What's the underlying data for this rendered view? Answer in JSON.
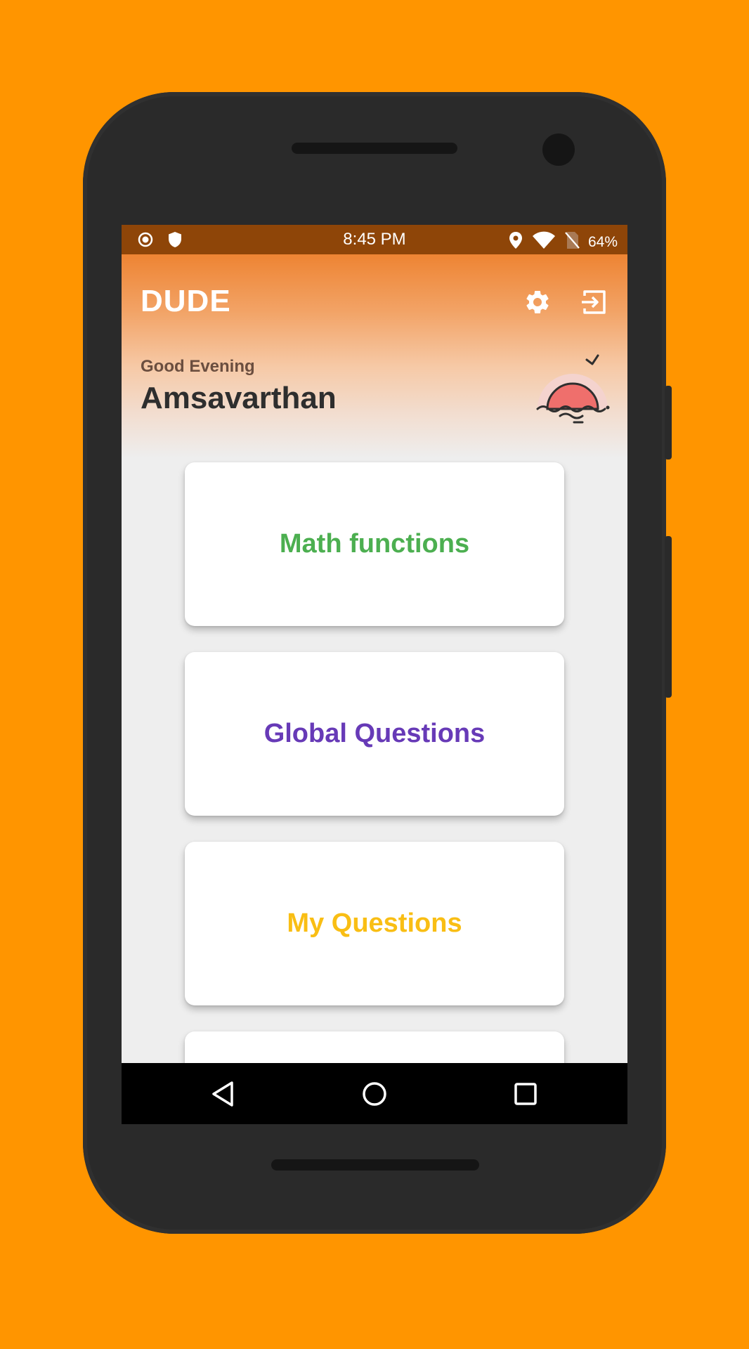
{
  "status_bar": {
    "time": "8:45 PM",
    "battery_percent": "64%",
    "left_icons": [
      "record-icon",
      "shield-icon"
    ],
    "right_icons": [
      "location-icon",
      "wifi-icon",
      "no-sim-icon"
    ]
  },
  "app_bar": {
    "title": "DUDE",
    "actions": [
      "settings-icon",
      "logout-icon"
    ]
  },
  "greeting": {
    "salutation": "Good Evening",
    "user_name": "Amsavarthan",
    "illustration": "sunset-icon"
  },
  "cards": [
    {
      "label": "Math functions",
      "color": "#4CAF50"
    },
    {
      "label": "Global Questions",
      "color": "#673AB7"
    },
    {
      "label": "My Questions",
      "color": "#F9BE14"
    },
    {
      "label": "",
      "color": "#000000"
    }
  ],
  "nav_bar": {
    "buttons": [
      "back-icon",
      "home-icon",
      "recents-icon"
    ]
  },
  "colors": {
    "background": "#FF9500",
    "status_bar": "#8E4508",
    "header_top": "#EE8433",
    "screen_bg": "#EEEEEE"
  }
}
